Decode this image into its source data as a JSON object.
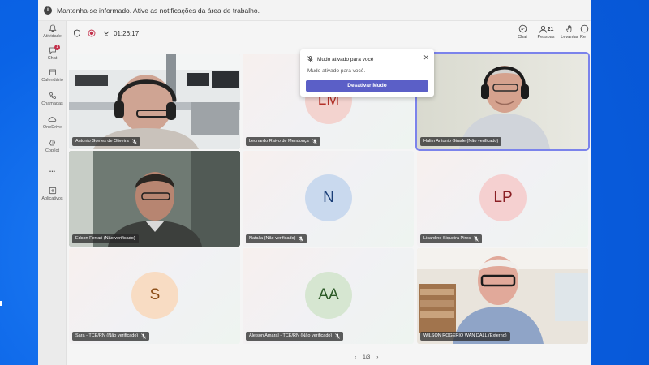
{
  "notification_bar": {
    "message": "Mantenha-se informado. Ative as notificações da área de trabalho."
  },
  "rail": {
    "items": [
      {
        "label": "Atividade",
        "icon": "bell-icon"
      },
      {
        "label": "Chat",
        "icon": "chat-icon",
        "badge": "1"
      },
      {
        "label": "Calendário",
        "icon": "calendar-icon"
      },
      {
        "label": "Chamadas",
        "icon": "phone-icon"
      },
      {
        "label": "OneDrive",
        "icon": "cloud-icon"
      },
      {
        "label": "Copilot",
        "icon": "copilot-icon"
      },
      {
        "label": "...",
        "icon": "more-icon"
      },
      {
        "label": "Aplicativos",
        "icon": "add-apps-icon"
      }
    ]
  },
  "meeting": {
    "timer": "01:26:17",
    "toolbar": {
      "chat_label": "Chat",
      "people_label": "Pessoas",
      "people_count": "21",
      "raise_label": "Levantar",
      "react_label": "Re"
    }
  },
  "popup": {
    "title": "Mudo ativado para você",
    "body": "Mudo ativado para você.",
    "button": "Desativar Mudo"
  },
  "participants": [
    {
      "name": "Antonio Gomes de Oliveira",
      "type": "video"
    },
    {
      "name": "Leonardo Raivo de Mendonça",
      "initials": "LM",
      "type": "avatar",
      "avatar_bg": "#f3d3cf",
      "avatar_fg": "#b4322a"
    },
    {
      "name": "Halim Antonio Girade (Não verificado)",
      "type": "video"
    },
    {
      "name": "Edson Ferrari (Não verificado)",
      "type": "video"
    },
    {
      "name": "Natalia (Não verificado)",
      "initials": "N",
      "type": "avatar",
      "avatar_bg": "#c9d9ee",
      "avatar_fg": "#1b3f78"
    },
    {
      "name": "Licardino Siqueira Pires",
      "initials": "LP",
      "type": "avatar",
      "avatar_bg": "#f5d0d0",
      "avatar_fg": "#8a1f24"
    },
    {
      "name": "Sara - TCE/RN (Não verificado)",
      "initials": "S",
      "type": "avatar",
      "avatar_bg": "#f8dcc3",
      "avatar_fg": "#8a4b14"
    },
    {
      "name": "Aleison Amaral - TCE/RN (Não verificado)",
      "initials": "AA",
      "type": "avatar",
      "avatar_bg": "#d6e6d1",
      "avatar_fg": "#2c5a27"
    },
    {
      "name": "WILSON ROGERIO WAN DALL (Externo)",
      "type": "video"
    }
  ],
  "pager": {
    "label": "1/3"
  }
}
